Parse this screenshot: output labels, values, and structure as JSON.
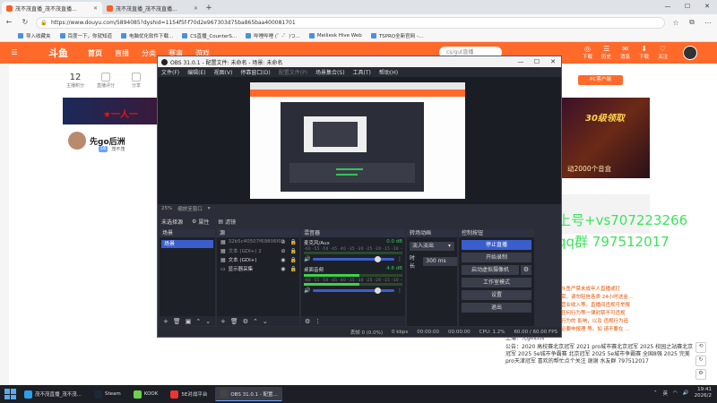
{
  "browser": {
    "tabs": [
      {
        "label": "茂不茂直播_茂不茂直播..."
      },
      {
        "label": "茂不茂直播_茂不茂直播..."
      }
    ],
    "new_tab": "+",
    "window_controls": {
      "min": "—",
      "max": "☐",
      "close": "✕"
    },
    "url": "https://www.douyu.com/5894085?dyshid=1154f5f-f70d2e967303d75ba865baa400081701",
    "bookmarks": [
      "导入收藏夹",
      "百度一下，你就知道",
      "电脑优化软件下载...",
      "CS直播_CounterS...",
      "哔哩哔哩 (゜-゜)つ...",
      "Meiliesk Hive Web",
      "TSPRO全新官网 -..."
    ]
  },
  "douyu": {
    "logo": "斗鱼",
    "menu": [
      "首页",
      "直播",
      "分类",
      "赛事",
      "游戏"
    ],
    "search_placeholder": "cs/gut直播",
    "right_items": [
      {
        "glyph": "◎",
        "label": "下载"
      },
      {
        "glyph": "☰",
        "label": "历史"
      },
      {
        "glyph": "✉",
        "label": "消息"
      },
      {
        "glyph": "⬇",
        "label": "下载"
      },
      {
        "glyph": "♡",
        "label": "关注"
      }
    ],
    "stats": [
      {
        "num": "12",
        "label": "主播积分"
      },
      {
        "num": "",
        "label": "直播评分"
      },
      {
        "num": "",
        "label": "分享"
      }
    ],
    "banner_text": "★一人一",
    "streamer_name": "先go后洲",
    "streamer_badge": "16",
    "streamer_sub": "茂不茂",
    "pc_button": "PC客户端",
    "ad_title": "30级领取",
    "ad_sub": "动2000个音盒",
    "overlay_line1": "上号+vs707223266",
    "overlay_line2": "qq群 797512017",
    "chat_lines": [
      "斗鱼严禁未成年人直播或打",
      "赏，请勿轻信各类 24小时送金...",
      "营业收入等。直播间违规可举报",
      "任何行为等一律封禁不可违规",
      "行为的 影响，以及 违规行为追",
      "必要申报理 等。如 请不要在 ..."
    ],
    "notice_anchor": "主播：先go后洲",
    "notice_text": "公告：2020 高校赛北京冠军 2021 pro城市赛北京冠军 2025 校园之站赛北京冠军 2025 5e城市争霸赛 北京冠军 2025 5e城市争霸赛 全国8强 2025 完美pro天津冠军 喜欢的帮忙点个关注 谢谢 水友群 797512017"
  },
  "obs": {
    "title": "OBS 31.0.1 - 配置文件: 未命名 - 场景: 未命名",
    "menu": [
      "文件(F)",
      "编辑(E)",
      "视图(V)",
      "停靠窗口(D)",
      "配置文件(P)",
      "场景集合(S)",
      "工具(T)",
      "帮助(H)"
    ],
    "zoom": "25%",
    "zoom_mode": "缩放至窗口",
    "no_source": "未选择源",
    "btn_properties": "属性",
    "btn_filters": "滤镜",
    "docks": {
      "scenes": "场景",
      "sources": "源",
      "mixer": "混音器",
      "transitions": "转场动画",
      "controls": "控制按钮"
    },
    "scenes": [
      "场景"
    ],
    "sources": [
      {
        "label": "32b5c40507f69806f03",
        "glyph": "▦",
        "dim": true
      },
      {
        "label": "文本 (GDI+) 2",
        "glyph": "▦",
        "dim": true
      },
      {
        "label": "文本 (GDI+)",
        "glyph": "▦",
        "dim": false
      },
      {
        "label": "显示器采集",
        "glyph": "▭",
        "dim": false
      }
    ],
    "mixer": [
      {
        "name": "麦克风/Aux",
        "db": "0.0 dB",
        "level": 0.0,
        "fader": 0.8
      },
      {
        "name": "桌面音频",
        "db": "4.6 dB",
        "level": 0.56,
        "fader": 0.8
      }
    ],
    "mixer_scale": "-60 -55 -50 -45 -40 -35 -30 -25 -20 -15 -10 -5 0",
    "transition_type": "淡入淡出",
    "duration_label": "时长",
    "duration_value": "300 ms",
    "controls": {
      "stop_stream": "停止直播",
      "start_record": "开始录制",
      "virtual_cam": "启动虚拟摄像机",
      "studio": "工作室模式",
      "settings": "设置",
      "exit": "退出"
    },
    "status": {
      "dropped": "丢帧 0 (0.0%)",
      "bitrate": "0 kbps",
      "stream_time": "00:00:00",
      "rec_time": "00:00:00",
      "cpu": "CPU: 1.2%",
      "fps": "60.00 / 60.00 FPS"
    }
  },
  "taskbar": {
    "items": [
      {
        "label": "茂不茂直播_茂不茂...",
        "color": "#29a0e6"
      },
      {
        "label": "Steam",
        "color": "#1b2838"
      },
      {
        "label": "KOOK",
        "color": "#6bd24a"
      },
      {
        "label": "5E对战平台",
        "color": "#e33"
      },
      {
        "label": "OBS 31.0.1 - 配置...",
        "color": "#444"
      }
    ],
    "ime": "英",
    "time": "19:41",
    "date": "2026/2"
  }
}
